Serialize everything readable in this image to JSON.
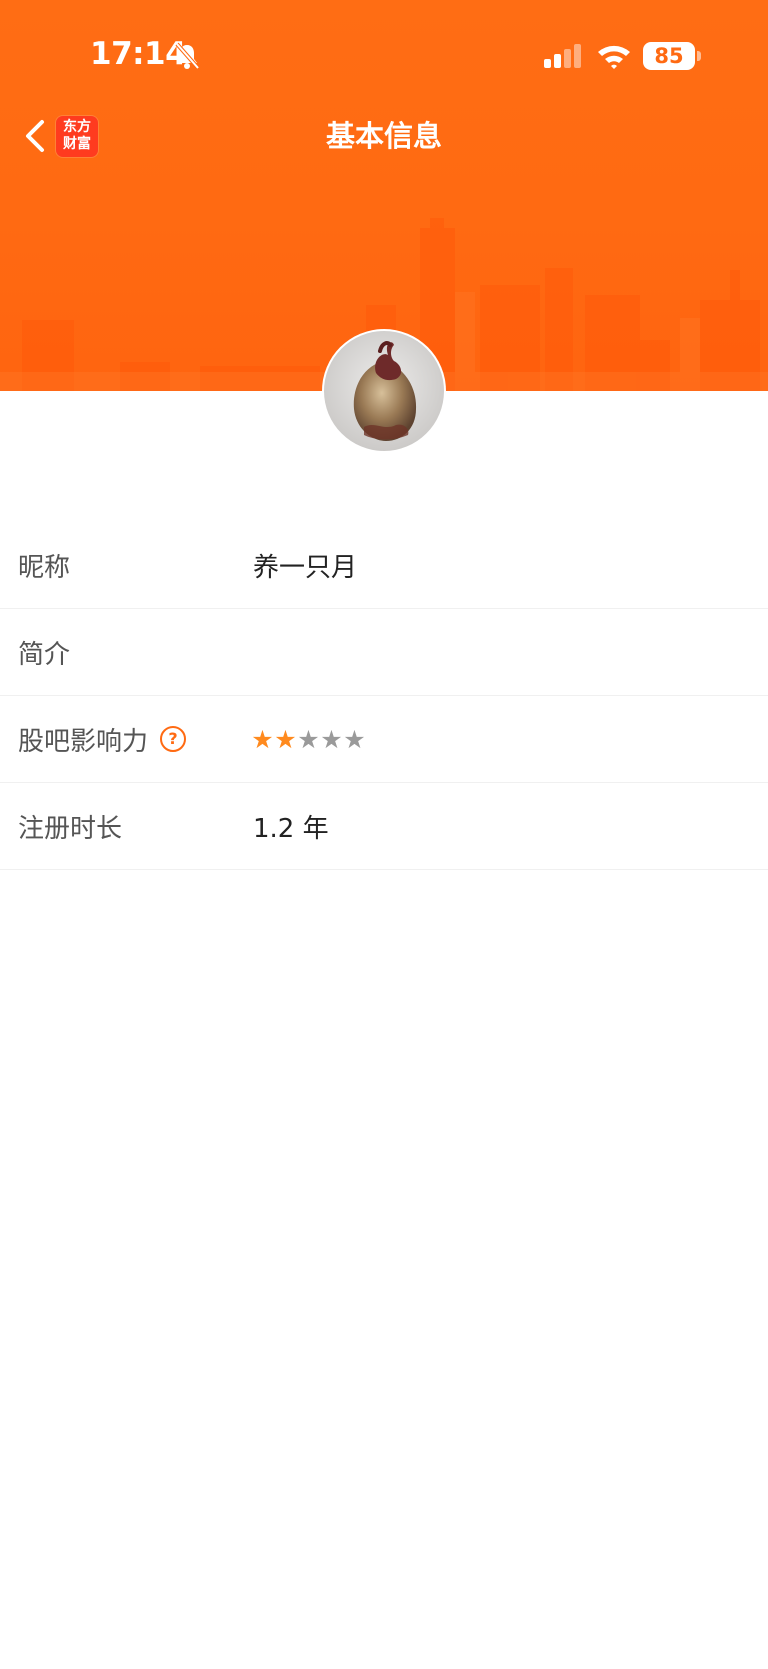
{
  "status_bar": {
    "time": "17:14",
    "battery": "85"
  },
  "nav": {
    "title": "基本信息",
    "brand_line1": "东方",
    "brand_line2": "财富"
  },
  "profile": {
    "rows": [
      {
        "label": "昵称",
        "value": "养一只月"
      },
      {
        "label": "简介",
        "value": ""
      },
      {
        "label": "股吧影响力",
        "help": "?",
        "rating": 2,
        "rating_max": 5
      },
      {
        "label": "注册时长",
        "value": "1.2 年"
      }
    ]
  },
  "icons": {
    "star": "★"
  },
  "colors": {
    "header_orange": "#ff6a12",
    "brand_red": "#ff3b1f",
    "star_on": "#ff8a1e",
    "star_off": "#9a9a9a"
  }
}
